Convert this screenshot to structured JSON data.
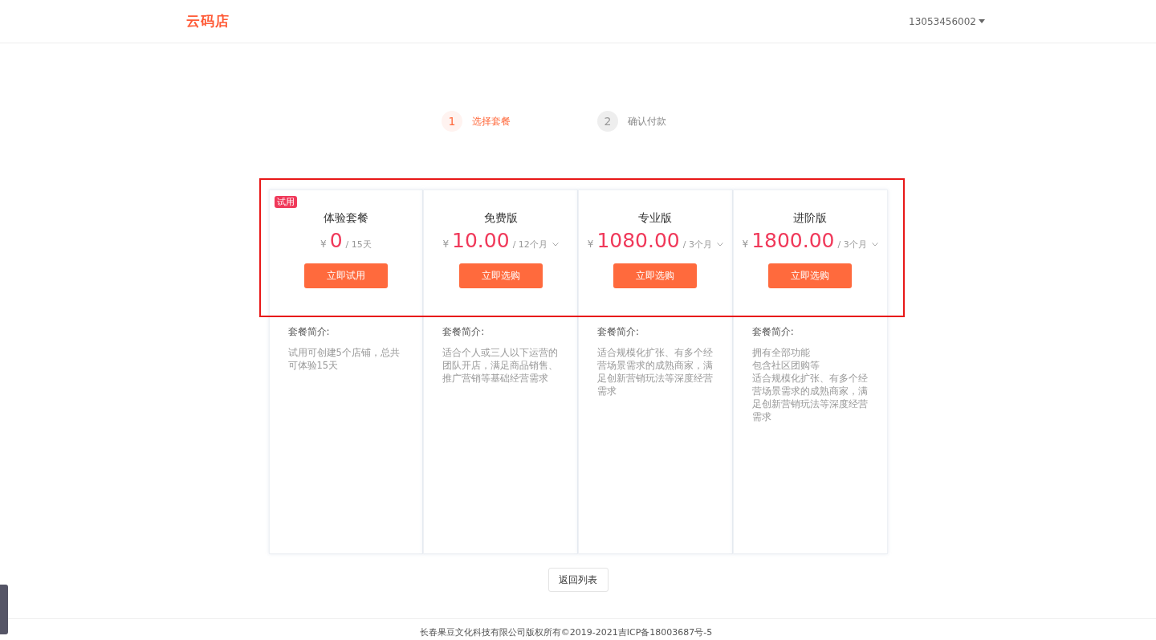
{
  "header": {
    "logo": "云码店",
    "user": "13053456002"
  },
  "steps": [
    {
      "number": "1",
      "label": "选择套餐",
      "selected": true
    },
    {
      "number": "2",
      "label": "确认付款",
      "selected": false
    }
  ],
  "plans": [
    {
      "badge": "试用",
      "name": "体验套餐",
      "currency": "¥",
      "price": "0",
      "period": "/ 15天",
      "dropdown": false,
      "button": "立即试用",
      "intro_title": "套餐简介:",
      "intro": [
        "试用可创建5个店铺，总共可体验15天"
      ]
    },
    {
      "name": "免费版",
      "currency": "¥",
      "price": "10.00",
      "period": "/ 12个月",
      "dropdown": true,
      "button": "立即选购",
      "intro_title": "套餐简介:",
      "intro": [
        "适合个人或三人以下运营的团队开店，满足商品销售、推广营销等基础经营需求"
      ]
    },
    {
      "name": "专业版",
      "currency": "¥",
      "price": "1080.00",
      "period": "/ 3个月",
      "dropdown": true,
      "button": "立即选购",
      "intro_title": "套餐简介:",
      "intro": [
        "适合规模化扩张、有多个经营场景需求的成熟商家，满足创新营销玩法等深度经营需求"
      ]
    },
    {
      "name": "进阶版",
      "currency": "¥",
      "price": "1800.00",
      "period": "/ 3个月",
      "dropdown": true,
      "button": "立即选购",
      "intro_title": "套餐简介:",
      "intro": [
        "拥有全部功能",
        "包含社区团购等",
        "适合规模化扩张、有多个经营场景需求的成熟商家，满足创新营销玩法等深度经营需求"
      ]
    }
  ],
  "back_button": "返回列表",
  "footer": "长春果豆文化科技有限公司版权所有©2019-2021吉ICP备18003687号-5"
}
